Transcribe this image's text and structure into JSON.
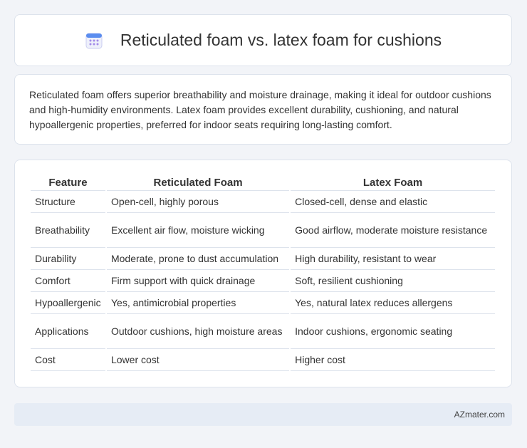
{
  "header": {
    "title": "Reticulated foam vs. latex foam for cushions",
    "icon": "calendar-icon",
    "accent_color": "#5b8def"
  },
  "summary": {
    "text": "Reticulated foam offers superior breathability and moisture drainage, making it ideal for outdoor cushions and high-humidity environments. Latex foam provides excellent durability, cushioning, and natural hypoallergenic properties, preferred for indoor seats requiring long-lasting comfort."
  },
  "table": {
    "headers": [
      "Feature",
      "Reticulated Foam",
      "Latex Foam"
    ],
    "rows": [
      [
        "Structure",
        "Open-cell, highly porous",
        "Closed-cell, dense and elastic"
      ],
      [
        "Breathability",
        "Excellent air flow, moisture wicking",
        "Good airflow, moderate moisture resistance"
      ],
      [
        "Durability",
        "Moderate, prone to dust accumulation",
        "High durability, resistant to wear"
      ],
      [
        "Comfort",
        "Firm support with quick drainage",
        "Soft, resilient cushioning"
      ],
      [
        "Hypoallergenic",
        "Yes, antimicrobial properties",
        "Yes, natural latex reduces allergens"
      ],
      [
        "Applications",
        "Outdoor cushions, high moisture areas",
        "Indoor cushions, ergonomic seating"
      ],
      [
        "Cost",
        "Lower cost",
        "Higher cost"
      ]
    ]
  },
  "footer": {
    "brand": "AZmater.com"
  }
}
